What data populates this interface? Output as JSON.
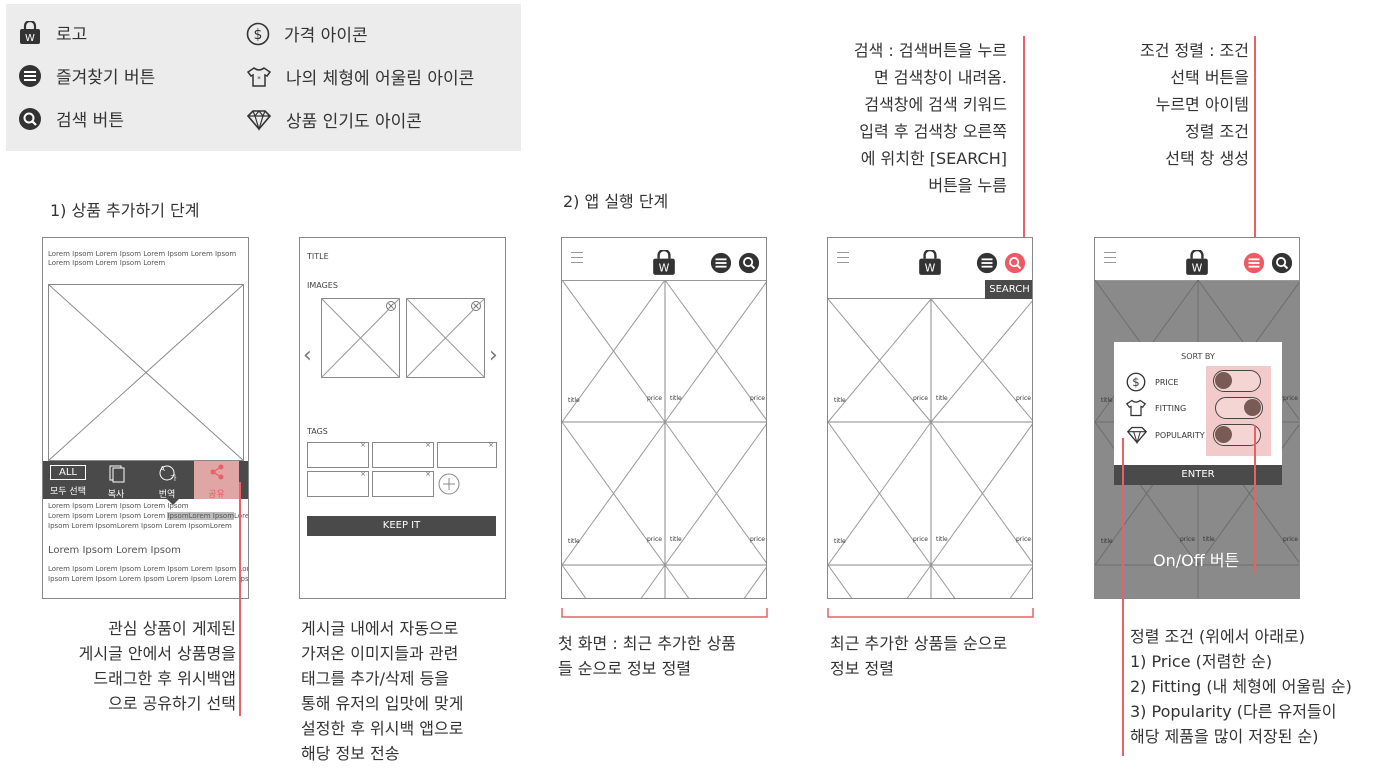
{
  "legend": {
    "logo": "로고",
    "favorite": "즐겨찾기 버튼",
    "search": "검색 버튼",
    "price": "가격 아이콘",
    "fitting": "나의 체형에 어울림 아이콘",
    "popularity": "상품 인기도 아이콘"
  },
  "step1": {
    "title": "1) 상품 추가하기 단계",
    "screen1": {
      "top_text": "Lorem Ipsom Lorem Ipsom Lorem Ipsom Lorem Ipsom Lorem Ipsom Lorem Ipsom Lorem",
      "menu_all": "ALL",
      "menu_select_all": "모두 선택",
      "menu_copy": "복사",
      "menu_translate": "번역",
      "menu_share": "공유",
      "body_line1": "Lorem Ipsom Lorem Ipsom Lorem Ipsom",
      "body_line2_a": "Lorem Ipsom Lorem Ipsom Lorem ",
      "body_line2_hl": "IpsomLorem Ipsom",
      "body_line2_b": "Lorem",
      "body_line3": "Ipsom Lorem IpsomLorem Ipsom Lorem IpsomLorem",
      "heading": "Lorem Ipsom Lorem Ipsom",
      "body_line4": "Lorem Ipsom Lorem Ipsom Lorem Ipsom Lorem Ipsom Lorem",
      "body_line5": "Ipsom Lorem Ipsom Lorem Ipsom Lorem Ipsom Lorem Ipsom"
    },
    "screen2": {
      "title_label": "TITLE",
      "images_label": "IMAGES",
      "tags_label": "TAGS",
      "keep_button": "KEEP IT"
    },
    "desc1": [
      "관심 상품이 게제된",
      "게시글 안에서 상품명을",
      "드래그한 후 위시백앱",
      "으로 공유하기 선택"
    ],
    "desc2": [
      "게시글 내에서 자동으로",
      "가져온 이미지들과 관련",
      "태그를 추가/삭제 등을",
      "통해 유저의 입맛에 맞게",
      "설정한 후 위시백 앱으로",
      "해당 정보 전송"
    ]
  },
  "step2": {
    "title": "2) 앱 실행 단계",
    "logo_letter": "W",
    "item_title": "title",
    "item_price": "price",
    "search_button": "SEARCH",
    "sort": {
      "title": "SORT BY",
      "price": "PRICE",
      "fitting": "FITTING",
      "popularity": "POPULARITY",
      "enter": "ENTER",
      "toggle_note": "On/Off 버튼"
    },
    "search_note": [
      "검색 : 검색버튼을 누르",
      "면 검색창이 내려옴.",
      "검색창에 검색 키워드",
      "입력 후 검색창 오른쪽",
      "에 위치한 [SEARCH]",
      "버튼을 누름"
    ],
    "sort_note": [
      "조건 정렬 : 조건",
      "선택 버튼을",
      "누르면 아이템",
      "정렬 조건",
      "선택 창 생성"
    ],
    "desc_first": [
      "첫 화면 : 최근 추가한 상품",
      "들 순으로 정보 정렬"
    ],
    "desc_recent": [
      "최근 추가한 상품들 순으로",
      "정보 정렬"
    ],
    "desc_sort": [
      "정렬 조건 (위에서 아래로)",
      "1) Price (저렴한 순)",
      "2) Fitting (내 체형에 어울림 순)",
      "3) Popularity (다른 유저들이",
      "해당 제품을 많이 저장된 순)"
    ]
  }
}
